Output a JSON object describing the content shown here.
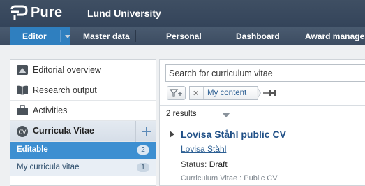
{
  "header": {
    "logo_text": "Pure",
    "organization": "Lund University"
  },
  "nav": {
    "editor": "Editor",
    "master_data": "Master data",
    "personal": "Personal",
    "dashboard": "Dashboard",
    "award_management": "Award manager"
  },
  "sidebar": {
    "items": [
      {
        "label": "Editorial overview",
        "icon": "chart-icon"
      },
      {
        "label": "Research output",
        "icon": "book-icon"
      },
      {
        "label": "Activities",
        "icon": "briefcase-icon"
      },
      {
        "label": "Curricula Vitae",
        "icon": "cv-icon"
      }
    ],
    "sub_items": [
      {
        "label": "Editable",
        "count": "2"
      },
      {
        "label": "My curricula vitae",
        "count": "1"
      }
    ]
  },
  "search": {
    "placeholder": "Search for curriculum vitae"
  },
  "filter": {
    "chip_label": "My content",
    "remove_symbol": "✕"
  },
  "results": {
    "count_label": "2 results",
    "items": [
      {
        "title": "Lovisa Ståhl public CV",
        "person": "Lovisa Ståhl",
        "status_label": "Status:",
        "status_value": "Draft",
        "type": "Curriculum Vitae : Public CV"
      }
    ]
  },
  "colors": {
    "header_bg": "#3a4a5f",
    "nav_active": "#2f7fbf",
    "link": "#1f4f86",
    "sub_active": "#3d8fd1"
  }
}
